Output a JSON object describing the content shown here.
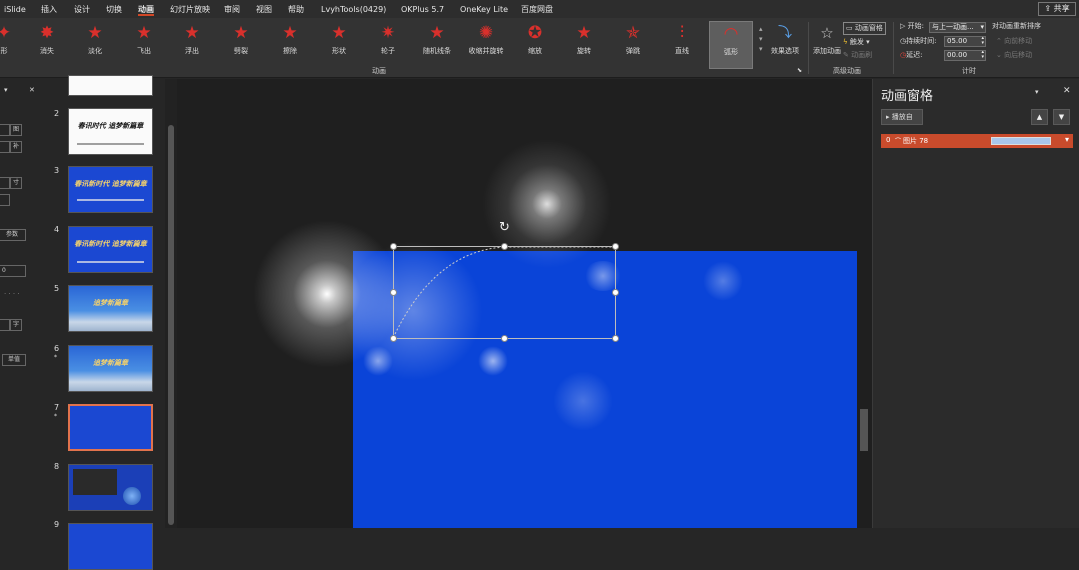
{
  "tabs": [
    "iSlide",
    "插入",
    "设计",
    "切换",
    "动画",
    "幻灯片放映",
    "审阅",
    "视图",
    "帮助",
    "LvyhTools(0429)",
    "OKPlus 5.7",
    "OneKey Lite",
    "百度网盘"
  ],
  "share_label": "共享",
  "effects": [
    "形",
    "消失",
    "淡化",
    "飞出",
    "浮出",
    "劈裂",
    "擦除",
    "形状",
    "轮子",
    "随机线条",
    "收缩并旋转",
    "缩放",
    "旋转",
    "弹跳",
    "直线",
    "弧形"
  ],
  "effect_options": "效果选项",
  "group_animation": "动画",
  "add_animation": "添加动画",
  "anim_pane_btn": "动画窗格",
  "trigger": "触发",
  "anim_painter": "动画刷",
  "group_advanced": "高级动画",
  "start_label": "开始:",
  "start_value": "与上一动画...",
  "duration_label": "持续时间:",
  "duration_value": "05.00",
  "delay_label": "延迟:",
  "delay_value": "00.00",
  "reorder_label": "对动画重新排序",
  "move_earlier": "向前移动",
  "move_later": "向后移动",
  "group_timing": "计时",
  "left_pane": {
    "labels": [
      "图",
      "补",
      "寸",
      "字",
      "参数",
      "0",
      "字",
      "单值"
    ]
  },
  "slides": [
    {
      "num": "2",
      "star": "",
      "title": "春讯时代 追梦新篇章"
    },
    {
      "num": "3",
      "star": "",
      "title": "春讯新时代 追梦新篇章"
    },
    {
      "num": "4",
      "star": "",
      "title": "春讯新时代 追梦新篇章"
    },
    {
      "num": "5",
      "star": "",
      "title": "追梦新篇章"
    },
    {
      "num": "6",
      "star": "*",
      "title": "追梦新篇章"
    },
    {
      "num": "7",
      "star": "*",
      "title": ""
    },
    {
      "num": "8",
      "star": "",
      "title": ""
    },
    {
      "num": "9",
      "star": "",
      "title": ""
    }
  ],
  "anim_pane": {
    "title": "动画窗格",
    "play_from": "播放自",
    "up": "▲",
    "down": "▼",
    "close": "✕",
    "item_index": "0",
    "item_name": "图片 78"
  }
}
